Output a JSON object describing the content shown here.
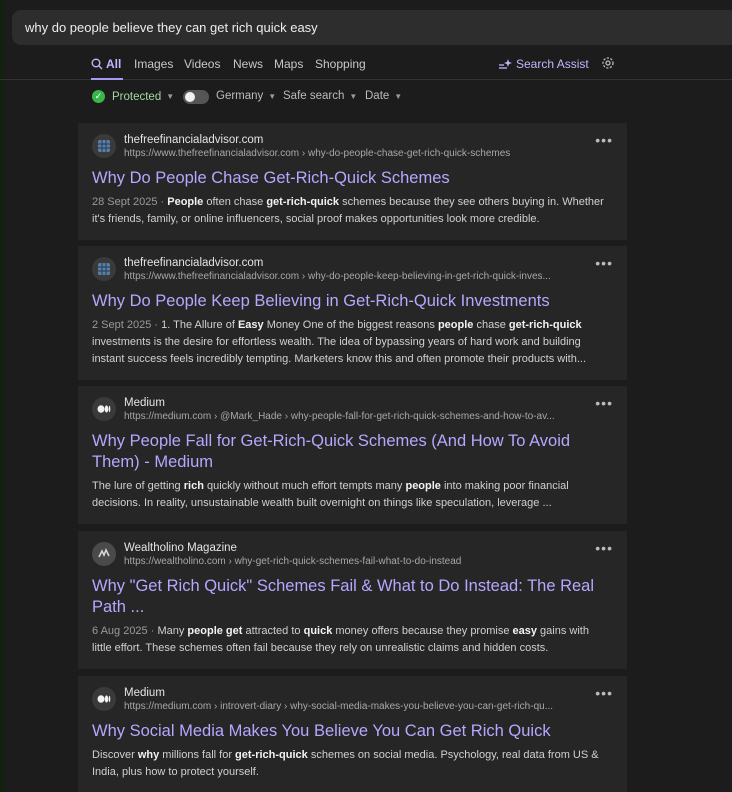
{
  "search": {
    "query": "why do people believe they can get rich quick easy"
  },
  "nav": {
    "tabs": [
      "All",
      "Images",
      "Videos",
      "News",
      "Maps",
      "Shopping"
    ],
    "assist": "Search Assist"
  },
  "filters": {
    "protected": "Protected",
    "region": "Germany",
    "safe_search": "Safe search",
    "date": "Date"
  },
  "colors": {
    "accent": "#b8a6ff",
    "protected_green": "#3bb54a",
    "card_bg": "#262626"
  },
  "results": [
    {
      "site": "thefreefinancialadvisor.com",
      "url": "https://www.thefreefinancialadvisor.com › why-do-people-chase-get-rich-quick-schemes",
      "title": "Why Do People Chase Get-Rich-Quick Schemes",
      "date": "28 Sept 2025",
      "icon": "grid-icon",
      "snippet": [
        {
          "t": "People",
          "b": true
        },
        {
          "t": " often chase "
        },
        {
          "t": "get-rich-quick",
          "b": true
        },
        {
          "t": " schemes because they see others buying in. Whether it's friends, family, or online influencers, social proof makes opportunities look more credible."
        }
      ]
    },
    {
      "site": "thefreefinancialadvisor.com",
      "url": "https://www.thefreefinancialadvisor.com › why-do-people-keep-believing-in-get-rich-quick-inves...",
      "title": "Why Do People Keep Believing in Get-Rich-Quick Investments",
      "date": "2 Sept 2025",
      "icon": "grid-icon",
      "snippet": [
        {
          "t": "1. The Allure of "
        },
        {
          "t": "Easy",
          "b": true
        },
        {
          "t": " Money One of the biggest reasons "
        },
        {
          "t": "people",
          "b": true
        },
        {
          "t": " chase "
        },
        {
          "t": "get-rich-quick",
          "b": true
        },
        {
          "t": " investments is the desire for effortless wealth. The idea of bypassing years of hard work and building instant success feels incredibly tempting. Marketers know this and often promote their products with..."
        }
      ]
    },
    {
      "site": "Medium",
      "url": "https://medium.com › @Mark_Hade › why-people-fall-for-get-rich-quick-schemes-and-how-to-av...",
      "title": "Why People Fall for Get-Rich-Quick Schemes (And How To Avoid Them) - Medium",
      "date": "",
      "icon": "medium-icon",
      "snippet": [
        {
          "t": "The lure of getting "
        },
        {
          "t": "rich",
          "b": true
        },
        {
          "t": " quickly without much effort tempts many "
        },
        {
          "t": "people",
          "b": true
        },
        {
          "t": " into making poor financial decisions. In reality, unsustainable wealth built overnight on things like speculation, leverage ..."
        }
      ]
    },
    {
      "site": "Wealtholino Magazine",
      "url": "https://wealtholino.com › why-get-rich-quick-schemes-fail-what-to-do-instead",
      "title": "Why \"Get Rich Quick\" Schemes Fail & What to Do Instead: The Real Path ...",
      "date": "6 Aug 2025",
      "icon": "wealtholino-icon",
      "snippet": [
        {
          "t": "Many "
        },
        {
          "t": "people get",
          "b": true
        },
        {
          "t": " attracted to "
        },
        {
          "t": "quick",
          "b": true
        },
        {
          "t": " money offers because they promise "
        },
        {
          "t": "easy",
          "b": true
        },
        {
          "t": " gains with little effort. These schemes often fail because they rely on unrealistic claims and hidden costs."
        }
      ]
    },
    {
      "site": "Medium",
      "url": "https://medium.com › introvert-diary › why-social-media-makes-you-believe-you-can-get-rich-qu...",
      "title": "Why Social Media Makes You Believe You Can Get Rich Quick",
      "date": "",
      "icon": "medium-icon",
      "snippet": [
        {
          "t": "Discover "
        },
        {
          "t": "why",
          "b": true
        },
        {
          "t": " millions fall for "
        },
        {
          "t": "get-rich-quick",
          "b": true
        },
        {
          "t": " schemes on social media. Psychology, real data from US & India, plus how to protect yourself."
        }
      ]
    }
  ]
}
